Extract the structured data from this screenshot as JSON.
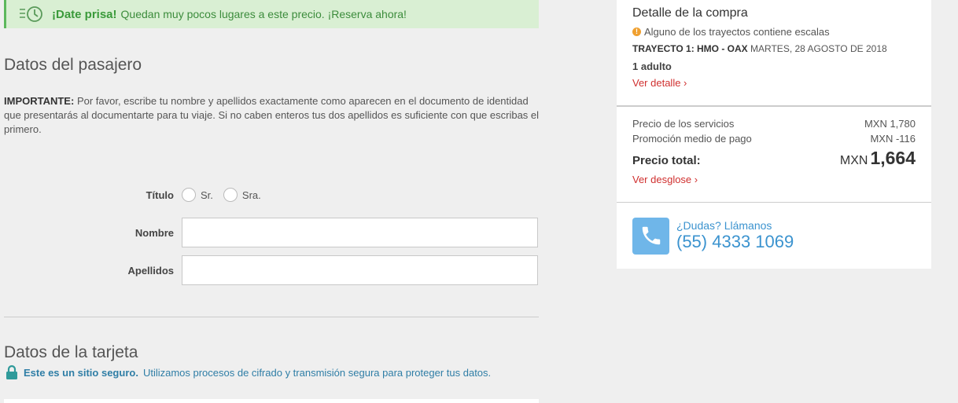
{
  "banner": {
    "icon": "clock-icon",
    "strong": "¡Date prisa!",
    "text": "Quedan muy pocos lugares a este precio. ¡Reserva ahora!",
    "accent": "#5cb85c"
  },
  "passenger": {
    "title": "Datos del pasajero",
    "important_label": "IMPORTANTE:",
    "important_text": "Por favor, escribe tu nombre y apellidos exactamente como aparecen en el documento de identidad que presentarás al documentarte para tu viaje. Si no caben enteros tus dos apellidos es suficiente con que escribas el primero.",
    "title_label": "Título",
    "options": [
      "Sr.",
      "Sra."
    ],
    "name_label": "Nombre",
    "name_value": "",
    "surname_label": "Apellidos",
    "surname_value": ""
  },
  "card": {
    "title": "Datos de la tarjeta",
    "secure_label": "Este es un sitio seguro.",
    "secure_text": "Utilizamos procesos de cifrado y transmisión segura para proteger tus datos."
  },
  "purchase": {
    "title": "Detalle de la compra",
    "warning": "Alguno de los trayectos contiene escalas",
    "route_label": "TRAYECTO 1: HMO - OAX",
    "route_date": "MARTES, 28 AGOSTO DE 2018",
    "passengers": "1 adulto",
    "detail_link": "Ver detalle ›",
    "service_label": "Precio de los servicios",
    "service_value": "MXN 1,780",
    "promo_label": "Promoción medio de pago",
    "promo_value": "MXN -116",
    "total_label": "Precio total:",
    "total_currency": "MXN",
    "total_value": "1,664",
    "breakdown_link": "Ver desglose ›"
  },
  "contact": {
    "question": "¿Dudas? Llámanos",
    "phone": "(55) 4333 1069",
    "color": "#3b93cf"
  }
}
